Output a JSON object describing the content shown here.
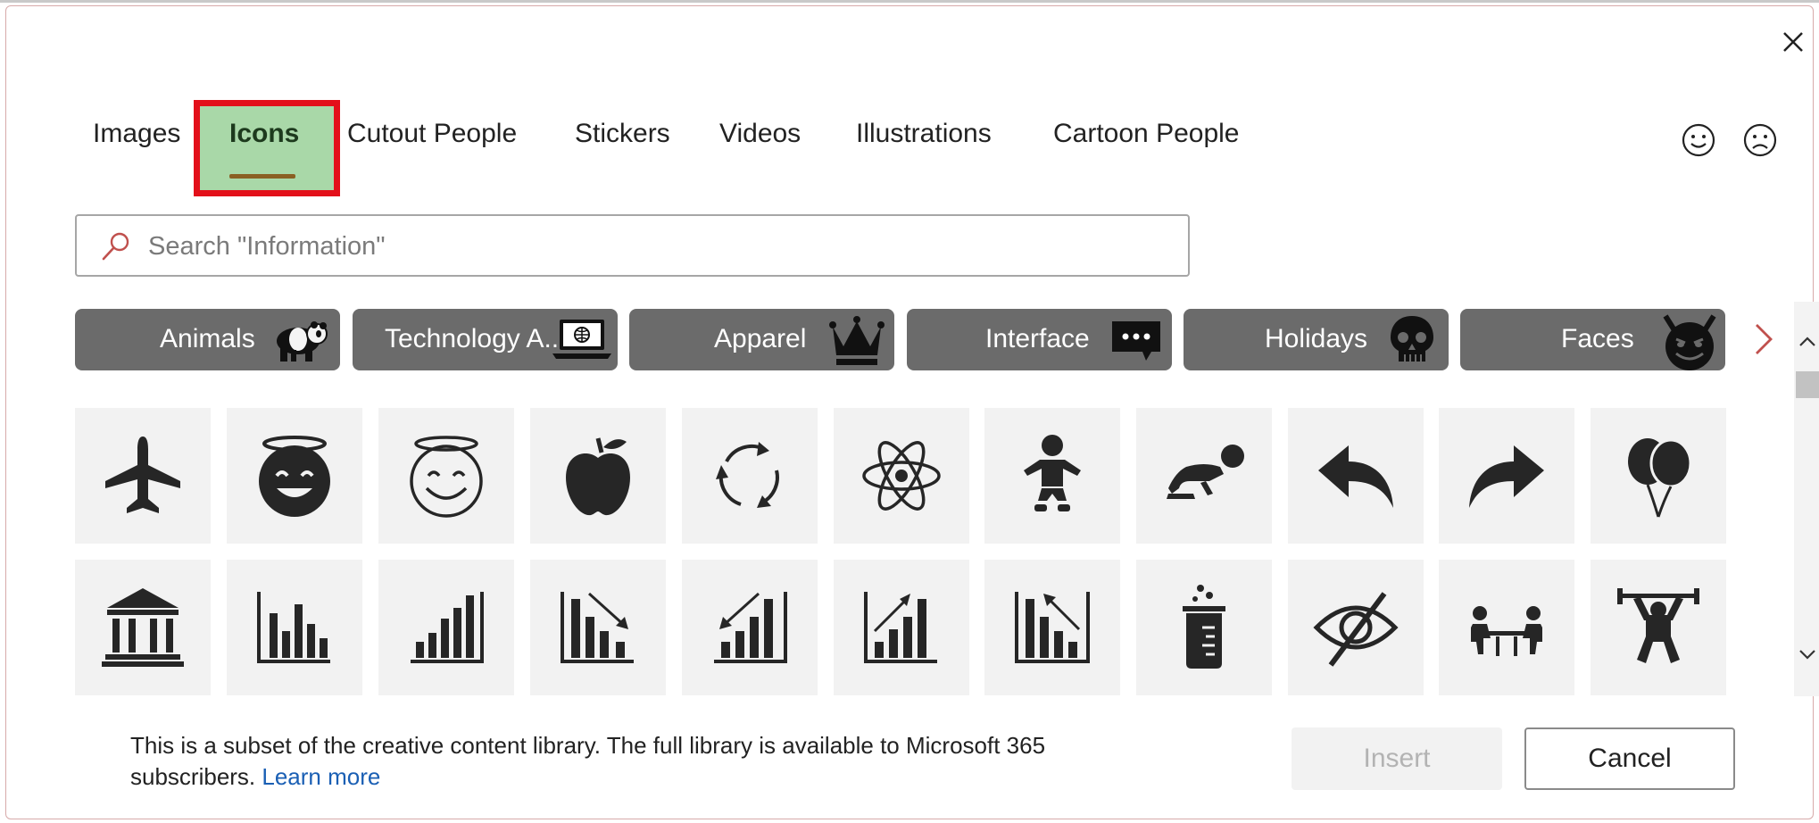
{
  "tabs": [
    {
      "label": "Images"
    },
    {
      "label": "Icons",
      "selected": true
    },
    {
      "label": "Cutout People"
    },
    {
      "label": "Stickers"
    },
    {
      "label": "Videos"
    },
    {
      "label": "Illustrations"
    },
    {
      "label": "Cartoon People"
    }
  ],
  "search": {
    "placeholder": "Search \"Information\"",
    "value": ""
  },
  "categories": [
    {
      "label": "Animals",
      "icon": "panda-icon"
    },
    {
      "label": "Technology A...",
      "icon": "laptop-icon"
    },
    {
      "label": "Apparel",
      "icon": "crown-icon"
    },
    {
      "label": "Interface",
      "icon": "chat-bubble-icon"
    },
    {
      "label": "Holidays",
      "icon": "skull-icon"
    },
    {
      "label": "Faces",
      "icon": "devil-face-icon"
    }
  ],
  "icon_grid": {
    "row1": [
      "airplane-icon",
      "halo-smiley-filled-icon",
      "halo-smiley-outline-icon",
      "apple-icon",
      "refresh-cycle-icon",
      "atom-icon",
      "baby-icon",
      "crawling-baby-icon",
      "reply-arrow-icon",
      "forward-arrow-icon",
      "balloons-icon"
    ],
    "row2": [
      "bank-icon",
      "bar-chart-icon",
      "bar-chart-rising-icon",
      "bar-chart-down-trend-icon",
      "bar-chart-down-left-icon",
      "bar-chart-up-trend-icon",
      "bar-chart-up-left-icon",
      "beaker-icon",
      "eye-slash-icon",
      "meeting-table-icon",
      "weightlifter-icon"
    ]
  },
  "footer": {
    "text": "This is a subset of the creative content library. The full library is available to Microsoft 365 subscribers.",
    "link": "Learn more"
  },
  "buttons": {
    "insert": "Insert",
    "cancel": "Cancel"
  },
  "colors": {
    "selected_tab_bg": "#a9d8a8",
    "highlight_border": "#e3101a",
    "category_bg": "#6b6b6b",
    "link": "#1a5fb4"
  }
}
